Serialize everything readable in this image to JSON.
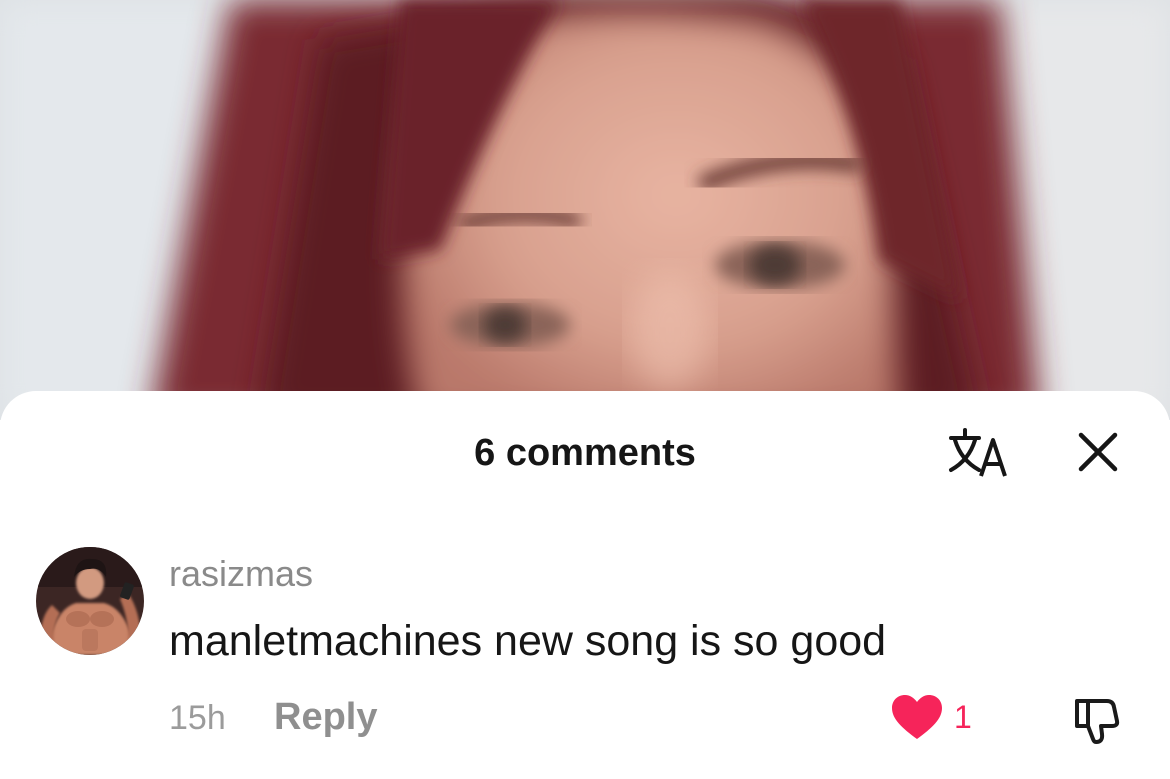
{
  "header": {
    "title": "6 comments",
    "translate_icon": "translate-icon",
    "close_icon": "close-icon"
  },
  "comments": [
    {
      "username": "rasizmas",
      "text": "manletmachines new song is so good",
      "time": "15h",
      "reply_label": "Reply",
      "likes": "1",
      "liked": true,
      "like_icon": "heart-icon",
      "dislike_icon": "thumbs-down-icon"
    }
  ],
  "colors": {
    "accent_like": "#f6245a",
    "text_primary": "#161616",
    "text_secondary": "#8a8a8a"
  }
}
